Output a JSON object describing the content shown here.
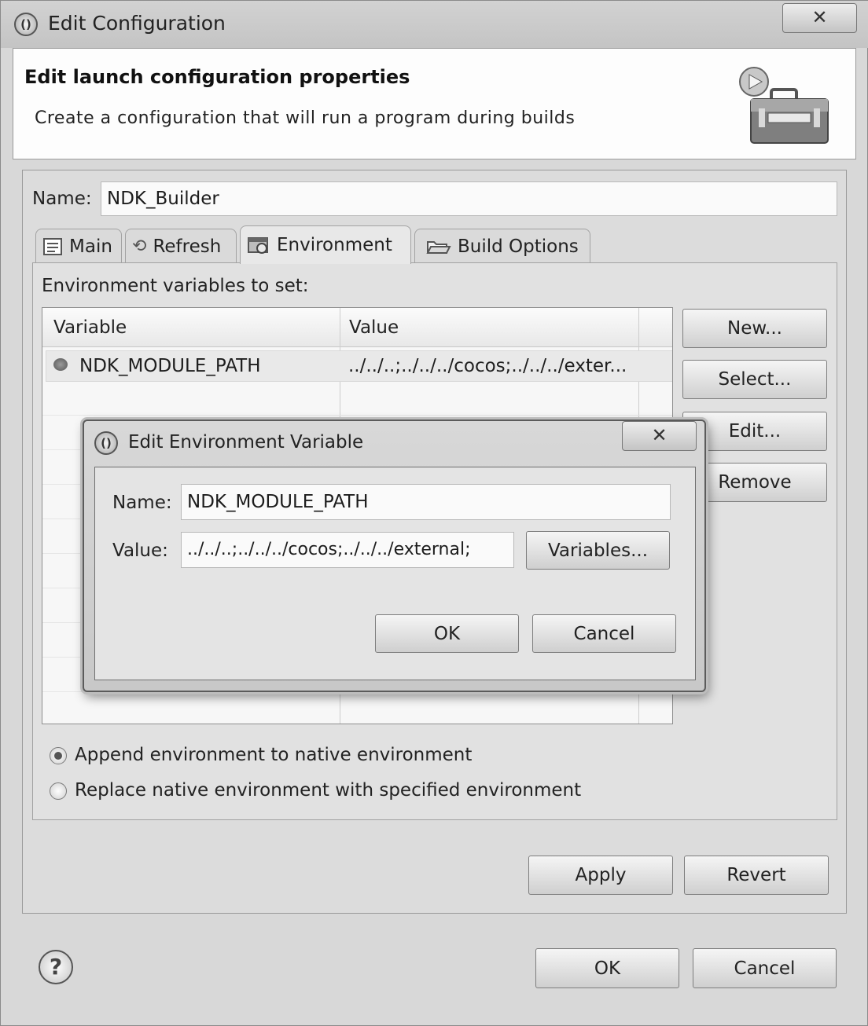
{
  "window": {
    "title": "Edit Configuration",
    "close_glyph": "✕"
  },
  "header": {
    "title": "Edit launch configuration properties",
    "description": "Create a configuration that will run a program during builds",
    "icon": "toolbox-run-icon"
  },
  "name_field": {
    "label": "Name:",
    "value": "NDK_Builder"
  },
  "tabs": [
    {
      "label": "Main",
      "icon": "main-tab-icon",
      "selected": false
    },
    {
      "label": "Refresh",
      "icon": "refresh-icon",
      "selected": false
    },
    {
      "label": "Environment",
      "icon": "environment-icon",
      "selected": true
    },
    {
      "label": "Build Options",
      "icon": "folder-open-icon",
      "selected": false
    }
  ],
  "environment": {
    "caption": "Environment variables to set:",
    "columns": [
      "Variable",
      "Value"
    ],
    "rows": [
      {
        "variable": "NDK_MODULE_PATH",
        "value": "../../..;../../../cocos;../../../exter..."
      }
    ],
    "buttons": {
      "new": "New...",
      "select": "Select...",
      "edit": "Edit...",
      "remove": "Remove"
    },
    "radio_append": "Append environment to native environment",
    "radio_replace": "Replace native environment with specified environment",
    "selected_mode": "append"
  },
  "actions": {
    "apply": "Apply",
    "revert": "Revert",
    "ok": "OK",
    "cancel": "Cancel"
  },
  "dialog": {
    "title": "Edit Environment Variable",
    "close_glyph": "✕",
    "name_label": "Name:",
    "name_value": "NDK_MODULE_PATH",
    "value_label": "Value:",
    "value_value": "../../..;../../../cocos;../../../external;",
    "variables_button": "Variables...",
    "ok": "OK",
    "cancel": "Cancel"
  },
  "colors": {
    "window_bg": "#d8d8d8",
    "header_bg": "#fdfdfd",
    "table_bg": "#f7f7f7"
  }
}
